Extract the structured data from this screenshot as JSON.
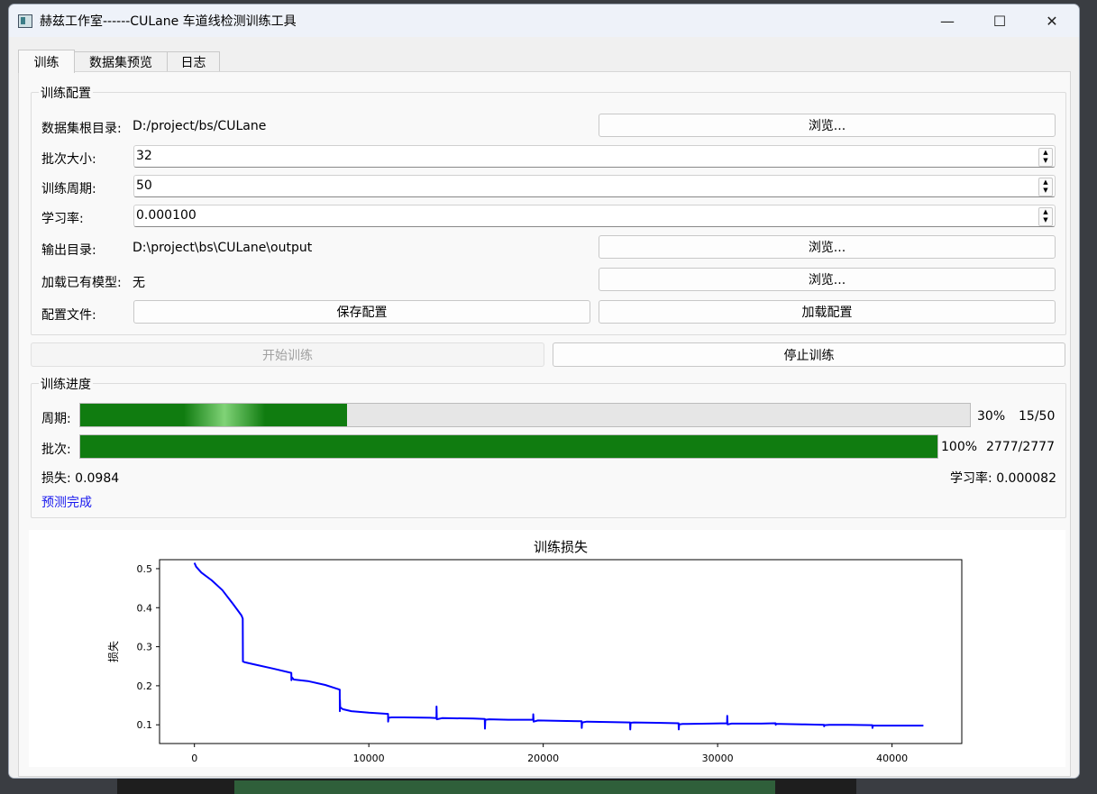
{
  "window": {
    "title": "赫兹工作室------CULane 车道线检测训练工具",
    "minimize_glyph": "—",
    "maximize_glyph": "☐",
    "close_glyph": "✕"
  },
  "tabs": [
    {
      "label": "训练",
      "active": true
    },
    {
      "label": "数据集预览",
      "active": false
    },
    {
      "label": "日志",
      "active": false
    }
  ],
  "config": {
    "group_title": "训练配置",
    "dataset_root_label": "数据集根目录:",
    "dataset_root_value": "D:/project/bs/CULane",
    "browse_label": "浏览...",
    "batch_size_label": "批次大小:",
    "batch_size_value": "32",
    "epochs_label": "训练周期:",
    "epochs_value": "50",
    "lr_label": "学习率:",
    "lr_value": "0.000100",
    "output_dir_label": "输出目录:",
    "output_dir_value": "D:\\project\\bs\\CULane\\output",
    "load_model_label": "加载已有模型:",
    "load_model_value": "无",
    "config_file_label": "配置文件:",
    "save_config_label": "保存配置",
    "load_config_label": "加载配置"
  },
  "actions": {
    "start_label": "开始训练",
    "stop_label": "停止训练"
  },
  "progress": {
    "group_title": "训练进度",
    "epoch_label": "周期:",
    "epoch_percent": "30%",
    "epoch_count": "15/50",
    "epoch_fraction": 0.3,
    "batch_label": "批次:",
    "batch_percent": "100%",
    "batch_count": "2777/2777",
    "batch_fraction": 1.0,
    "loss_text": "损失: 0.0984",
    "lr_text": "学习率: 0.000082",
    "status_text": "预测完成",
    "accent_color": "#107c10"
  },
  "chart_data": {
    "type": "line",
    "title": "训练损失",
    "xlabel": "批次",
    "ylabel": "损失",
    "xlim": [
      -2000,
      44000
    ],
    "ylim": [
      0.052,
      0.523
    ],
    "xticks": [
      0,
      10000,
      20000,
      30000,
      40000
    ],
    "yticks": [
      0.1,
      0.2,
      0.3,
      0.4,
      0.5
    ],
    "color": "#0000ff",
    "grid": false,
    "series": [
      {
        "x": [
          0,
          100,
          400,
          1000,
          1600,
          2200,
          2700,
          2770,
          2780,
          2900,
          3500,
          4500,
          5554,
          5560,
          5580,
          5700,
          6500,
          7500,
          8330,
          8335,
          8340,
          8360,
          8500,
          9000,
          10000,
          11100,
          11110,
          11130,
          11300,
          12000,
          13500,
          13880,
          13885,
          13900,
          14200,
          16000,
          16650,
          16660,
          16680,
          16900,
          18000,
          19420,
          19430,
          19450,
          19700,
          21000,
          22200,
          22210,
          22230,
          22500,
          24000,
          24980,
          24990,
          25010,
          25200,
          26500,
          27760,
          27770,
          27790,
          28000,
          29500,
          30540,
          30550,
          30570,
          30800,
          32500,
          33320,
          33330,
          33350,
          33600,
          35000,
          36100,
          36110,
          36130,
          36400,
          37500,
          38870,
          38880,
          38900,
          39200,
          40500,
          41800
        ],
        "y": [
          0.515,
          0.505,
          0.49,
          0.47,
          0.445,
          0.41,
          0.38,
          0.372,
          0.262,
          0.26,
          0.254,
          0.244,
          0.233,
          0.214,
          0.222,
          0.216,
          0.212,
          0.202,
          0.19,
          0.135,
          0.165,
          0.145,
          0.14,
          0.135,
          0.131,
          0.128,
          0.108,
          0.118,
          0.119,
          0.119,
          0.118,
          0.117,
          0.147,
          0.114,
          0.117,
          0.116,
          0.115,
          0.09,
          0.113,
          0.114,
          0.113,
          0.113,
          0.127,
          0.108,
          0.111,
          0.11,
          0.109,
          0.092,
          0.106,
          0.108,
          0.107,
          0.106,
          0.088,
          0.105,
          0.106,
          0.105,
          0.104,
          0.088,
          0.101,
          0.102,
          0.103,
          0.104,
          0.123,
          0.101,
          0.103,
          0.103,
          0.104,
          0.1,
          0.102,
          0.102,
          0.101,
          0.1,
          0.096,
          0.099,
          0.1,
          0.1,
          0.099,
          0.092,
          0.098,
          0.098,
          0.098,
          0.098
        ]
      }
    ]
  }
}
